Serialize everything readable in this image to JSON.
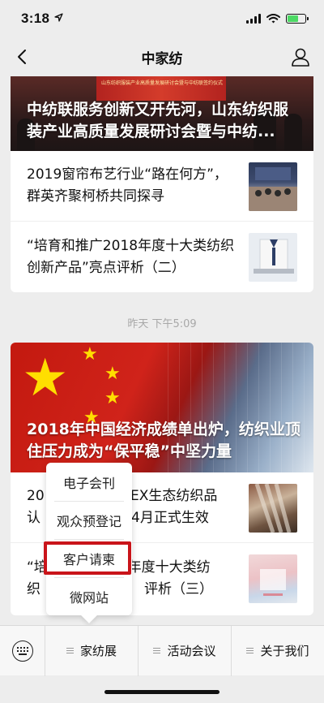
{
  "status_bar": {
    "time": "3:18",
    "battery_level": 0.6,
    "battery_color": "#4cd964"
  },
  "nav": {
    "title": "中家纺"
  },
  "card1": {
    "hero_title": "中纺联服务创新又开先河，山东纺织服装产业高质量发展研讨会暨与中纺...",
    "banner_text": "山东纺织服装产业高质量发展研讨会暨与中纺联签约仪式",
    "items": [
      {
        "title": "2019窗帘布艺行业“路在何方”，群英齐聚柯桥共同探寻"
      },
      {
        "title": "“培育和推广2018年度十大类纺织创新产品”亮点评析（二）"
      }
    ]
  },
  "timestamp": "昨天 下午5:09",
  "card2": {
    "hero_title": "2018年中国经济成绩单出炉，纺织业顶住压力成为“保平稳”中坚力量",
    "items": [
      {
        "title_left": "20",
        "title_right": "TEX生态纺织品",
        "line2_left": "认",
        "line2_right": "4月正式生效"
      },
      {
        "title_left": "“培",
        "title_right": "8年度十大类纺",
        "line2_left": "织",
        "line2_right": "评析（三）"
      }
    ]
  },
  "submenu": {
    "items": [
      "电子会刊",
      "观众预登记",
      "客户请柬",
      "微网站"
    ],
    "highlight_color": "#c9141a"
  },
  "menu": {
    "items": [
      {
        "label": "家纺展"
      },
      {
        "label": "活动会议"
      },
      {
        "label": "关于我们"
      }
    ]
  }
}
